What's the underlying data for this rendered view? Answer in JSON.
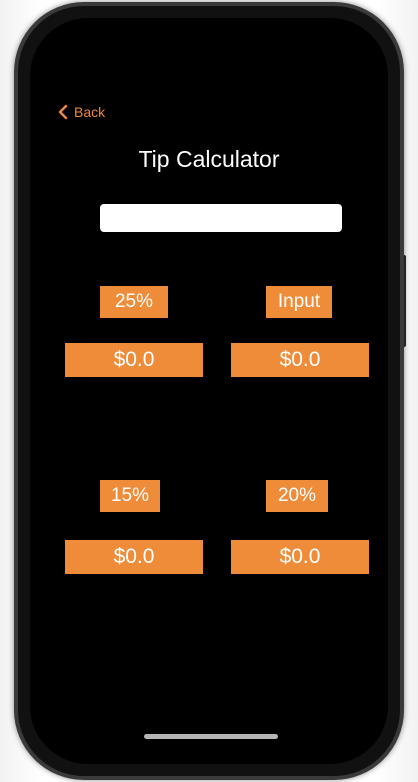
{
  "nav": {
    "back_label": "Back"
  },
  "header": {
    "title": "Tip Calculator"
  },
  "bill_input": {
    "value": "",
    "placeholder": ""
  },
  "tips": [
    {
      "label": "25%",
      "amount": "$0.0"
    },
    {
      "label": "Input",
      "amount": "$0.0"
    },
    {
      "label": "15%",
      "amount": "$0.0"
    },
    {
      "label": "20%",
      "amount": "$0.0"
    }
  ],
  "colors": {
    "accent": "#ee8c3a",
    "background": "#000000",
    "text": "#ffffff"
  },
  "icons": {
    "back": "chevron-left-icon"
  }
}
